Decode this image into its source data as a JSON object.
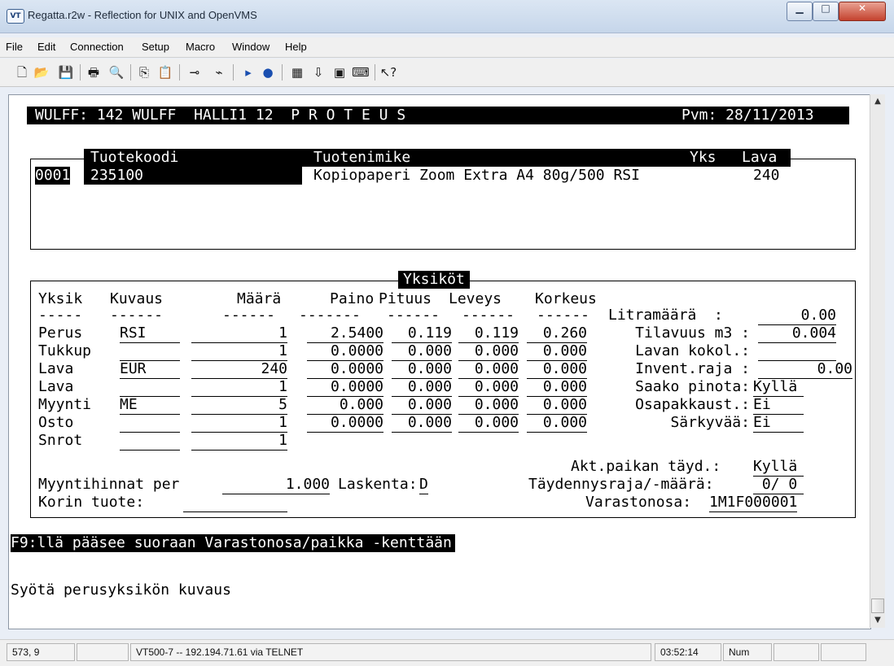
{
  "window": {
    "title": "Regatta.r2w - Reflection for UNIX and OpenVMS",
    "icon_label": "VT",
    "min_glyph": "▁",
    "max_glyph": "□",
    "close_glyph": "✕"
  },
  "menu": [
    "File",
    "Edit",
    "Connection",
    "Setup",
    "Macro",
    "Window",
    "Help"
  ],
  "toolbar_icons": [
    "new-document-icon",
    "open-folder-icon",
    "save-icon",
    "print-icon",
    "find-icon",
    "copy-icon",
    "paste-icon",
    "connect-icon",
    "disconnect-icon",
    "play-macro-icon",
    "record-macro-icon",
    "settings-icon",
    "transfer-icon",
    "display-icon",
    "keyboard-icon",
    "help-pointer-icon"
  ],
  "terminal": {
    "header": {
      "left": "WULFF: 142 WULFF  HALLI1 12  P R O T E U S",
      "right": "Pvm: 28/11/2013"
    },
    "product_box": {
      "col_code": "Tuotekoodi",
      "col_name": "Tuotenimike",
      "col_unit": "Yks",
      "col_pallet": "Lava",
      "row": {
        "no": "0001",
        "code": "235100",
        "name": "Kopiopaperi Zoom Extra A4 80g/500 RSI",
        "pallet": "240"
      }
    },
    "units_box": {
      "title": "Yksiköt",
      "headers": {
        "unit": "Yksik",
        "desc": "Kuvaus",
        "qty": "Määrä",
        "weight": "Paino",
        "length": "Pituus",
        "width": "Leveys",
        "height": "Korkeus"
      },
      "dashes": {
        "unit": "-----",
        "desc": "------",
        "qty": "------",
        "weight": "-------",
        "length": "------",
        "width": "------",
        "height": "------"
      },
      "rows": [
        {
          "unit": "Perus",
          "desc": "RSI",
          "qty": "1",
          "weight": "2.5400",
          "length": "0.119",
          "width": "0.119",
          "height": "0.260",
          "side_label": "Tilavuus m3 :",
          "side_value": "0.004"
        },
        {
          "unit": "Tukkup",
          "desc": "",
          "qty": "1",
          "weight": "0.0000",
          "length": "0.000",
          "width": "0.000",
          "height": "0.000",
          "side_label": "Lavan kokol.:",
          "side_value": ""
        },
        {
          "unit": "Lava",
          "desc": "EUR",
          "qty": "240",
          "weight": "0.0000",
          "length": "0.000",
          "width": "0.000",
          "height": "0.000",
          "side_label": "Invent.raja :",
          "side_value": "0.00"
        },
        {
          "unit": "Lava",
          "desc": "",
          "qty": "1",
          "weight": "0.0000",
          "length": "0.000",
          "width": "0.000",
          "height": "0.000",
          "side_label": "Saako pinota:",
          "side_value": "Kyllä"
        },
        {
          "unit": "Myynti",
          "desc": "ME",
          "qty": "5",
          "weight": "0.000",
          "length": "0.000",
          "width": "0.000",
          "height": "0.000",
          "side_label": "Osapakkaust.:",
          "side_value": "Ei"
        },
        {
          "unit": "Osto",
          "desc": "",
          "qty": "1",
          "weight": "0.0000",
          "length": "0.000",
          "width": "0.000",
          "height": "0.000",
          "side_label": "Särkyvää:",
          "side_value": "Ei"
        },
        {
          "unit": "Snrot",
          "desc": "",
          "qty": "1"
        }
      ],
      "litra_label": "Litramäärä  :",
      "litra_value": "0.00",
      "akt_label": "Akt.paikan täyd.:",
      "akt_value": "Kyllä",
      "price_label": "Myyntihinnat per",
      "price_value": "1.000",
      "laskenta_label": "Laskenta:",
      "laskenta_value": "D",
      "taydennys_label": "Täydennysraja/-määrä:",
      "taydennys_value": " 0/ 0",
      "korin_label": "Korin tuote:",
      "varastonosa_label": "Varastonosa:",
      "varastonosa_value": "1M1F000001"
    },
    "hint": "F9:llä pääsee suoraan Varastonosa/paikka -kenttään",
    "prompt": "Syötä perusyksikön kuvaus"
  },
  "status": {
    "cursor": "573, 9",
    "blank1": "",
    "connection": "VT500-7 -- 192.194.71.61 via TELNET",
    "time": "03:52:14",
    "num": "Num"
  }
}
